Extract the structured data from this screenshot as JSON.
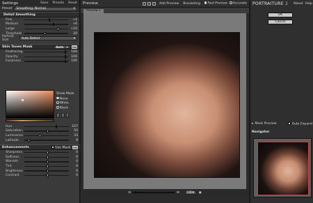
{
  "left": {
    "title": "Settings",
    "save": "Save",
    "presets": "Presets",
    "reset": "Reset",
    "preset_label": "Preset",
    "preset_value": "Smoothing: Normal",
    "detail": {
      "title": "Detail Smoothing",
      "rows": [
        {
          "label": "Fine",
          "value": "+2"
        },
        {
          "label": "Medium",
          "value": "+6"
        },
        {
          "label": "Large",
          "value": "+10"
        },
        {
          "label": "Threshold",
          "value": "20"
        }
      ],
      "portrait_label": "Portrait Size",
      "portrait_value": "Auto Detect"
    },
    "skin": {
      "title": "Skin Tones Mask",
      "mode": "Auto",
      "on": "ON",
      "rows": [
        {
          "label": "Feathering",
          "value": "100"
        },
        {
          "label": "Opacity",
          "value": "100"
        },
        {
          "label": "Fuzziness",
          "value": "100"
        }
      ],
      "show_mask": "Show Mask",
      "opt_none": "None",
      "opt_white": "White",
      "opt_black": "Black",
      "rows2": [
        {
          "label": "Hue",
          "value": "107"
        },
        {
          "label": "Saturation",
          "value": "50"
        },
        {
          "label": "Luminance",
          "value": "33"
        },
        {
          "label": "Latitude",
          "value": "8"
        }
      ]
    },
    "enh": {
      "title": "Enhancements",
      "use_mask": "Use Mask",
      "on": "ON",
      "rows": [
        {
          "label": "Sharpness",
          "value": "0"
        },
        {
          "label": "Softness",
          "value": "0"
        },
        {
          "label": "Warmth",
          "value": "0"
        },
        {
          "label": "Tint",
          "value": "0"
        },
        {
          "label": "Brightness",
          "value": "0"
        },
        {
          "label": "Contrast",
          "value": "0"
        }
      ]
    }
  },
  "center": {
    "title": "Preview",
    "add_preview": "Add Preview",
    "bracketing": "Bracketing",
    "fast_preview": "Fast Preview",
    "accurate": "Accurate",
    "tab": "Preview 1",
    "zoom": "100"
  },
  "right": {
    "logo_main": "PORTRAITURE",
    "logo_num": "2",
    "about": "About",
    "help": "Help",
    "ok": "OK",
    "cancel": "Cancel",
    "mask_preview": "Mask Preview",
    "auto_expand": "Auto Expand",
    "navigator": "Navigator"
  }
}
